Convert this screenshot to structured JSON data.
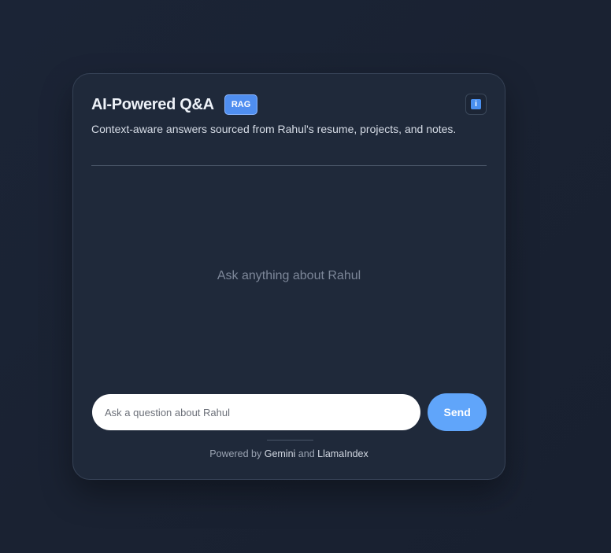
{
  "header": {
    "title": "AI-Powered Q&A",
    "badge": "RAG",
    "info_icon": "info-icon"
  },
  "subtitle": "Context-aware answers sourced from Rahul's resume, projects, and notes.",
  "chat": {
    "empty_message": "Ask anything about Rahul"
  },
  "input": {
    "placeholder": "Ask a question about Rahul",
    "value": "",
    "send_label": "Send"
  },
  "footer": {
    "prefix": "Powered by ",
    "provider1": "Gemini",
    "joiner": " and ",
    "provider2": "LlamaIndex"
  },
  "colors": {
    "accent": "#60a5fa",
    "badge": "#4f8ef0",
    "card": "#1f293a",
    "background": "#1a2233"
  }
}
